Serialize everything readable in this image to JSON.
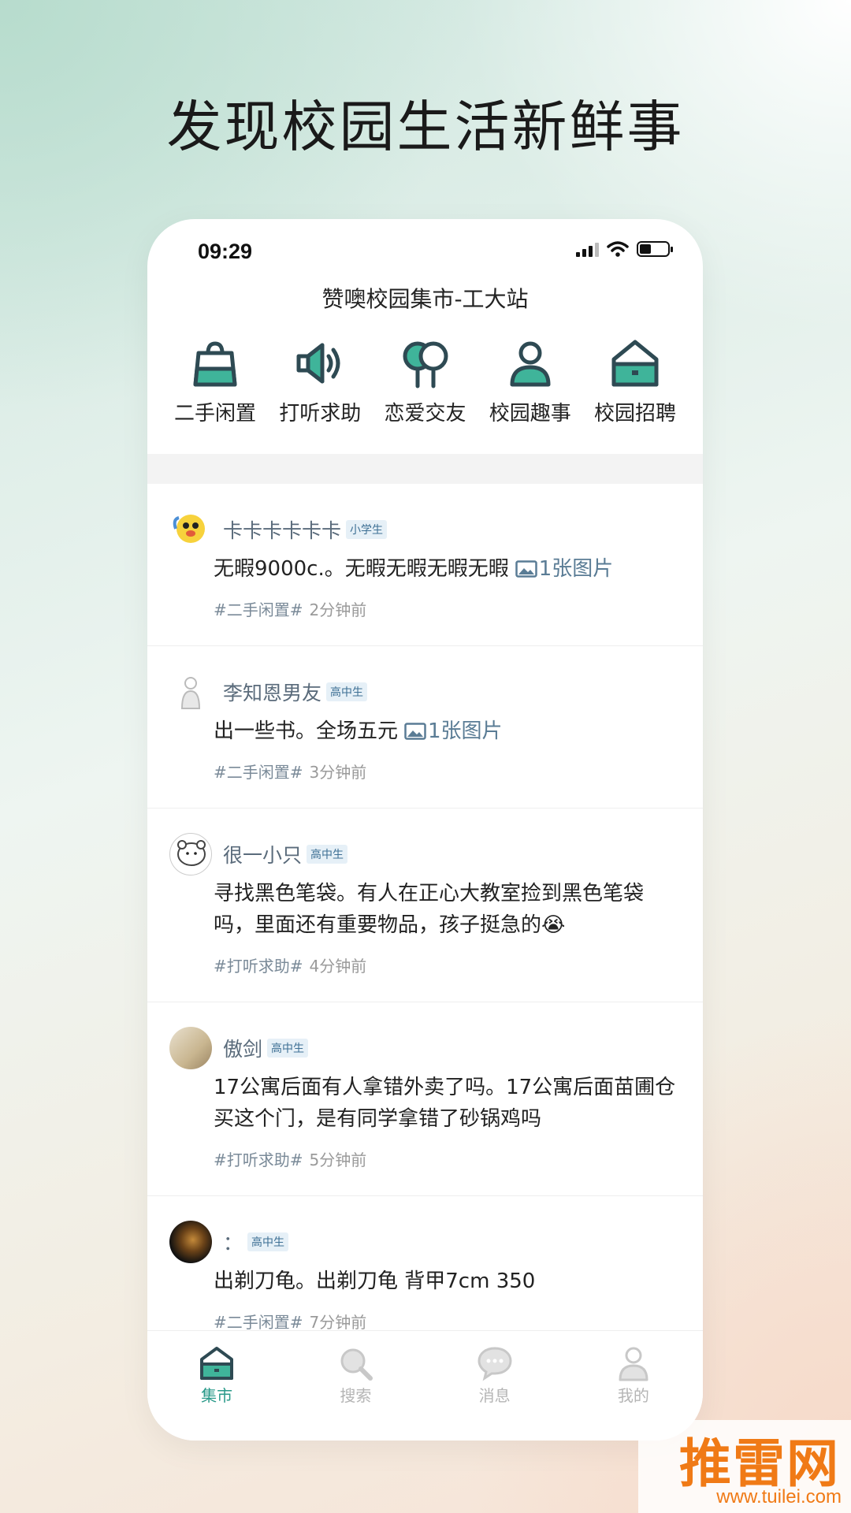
{
  "headline": "发现校园生活新鲜事",
  "status_bar": {
    "time": "09:29",
    "battery_level": 0.4
  },
  "app_title": "赞噢校园集市-工大站",
  "categories": [
    {
      "label": "二手闲置",
      "icon": "shopping-bag-icon"
    },
    {
      "label": "打听求助",
      "icon": "speaker-icon"
    },
    {
      "label": "恋爱交友",
      "icon": "balloons-icon"
    },
    {
      "label": "校园趣事",
      "icon": "person-icon"
    },
    {
      "label": "校园招聘",
      "icon": "house-icon"
    }
  ],
  "posts": [
    {
      "username": "卡卡卡卡卡卡",
      "badge": "小学生",
      "text": "无暇9000c.。无暇无暇无暇无暇",
      "image_label": "1张图片",
      "tag": "#二手闲置#",
      "time": "2分钟前"
    },
    {
      "username": "李知恩男友",
      "badge": "高中生",
      "text": "出一些书。全场五元",
      "image_label": "1张图片",
      "tag": "#二手闲置#",
      "time": "3分钟前"
    },
    {
      "username": "很一小只",
      "badge": "高中生",
      "text": "寻找黑色笔袋。有人在正心大教室捡到黑色笔袋吗，里面还有重要物品，孩子挺急的😭",
      "tag": "#打听求助#",
      "time": "4分钟前"
    },
    {
      "username": "傲剑",
      "badge": "高中生",
      "text": "17公寓后面有人拿错外卖了吗。17公寓后面苗圃仓买这个门，是有同学拿错了砂锅鸡吗",
      "tag": "#打听求助#",
      "time": "5分钟前"
    },
    {
      "username": "：",
      "badge": "高中生",
      "text": "出剃刀龟。出剃刀龟 背甲7cm 350",
      "tag": "#二手闲置#",
      "time": "7分钟前"
    }
  ],
  "tabbar": [
    {
      "label": "集市",
      "icon": "market-icon",
      "active": true
    },
    {
      "label": "搜索",
      "icon": "search-icon",
      "active": false
    },
    {
      "label": "消息",
      "icon": "message-icon",
      "active": false
    },
    {
      "label": "我的",
      "icon": "profile-icon",
      "active": false
    }
  ],
  "watermark": {
    "logo": "推雷网",
    "url": "www.tuilei.com"
  },
  "colors": {
    "accent": "#2a9a8a",
    "icon_dark": "#2e4a53",
    "icon_fill": "#3fb49a"
  }
}
